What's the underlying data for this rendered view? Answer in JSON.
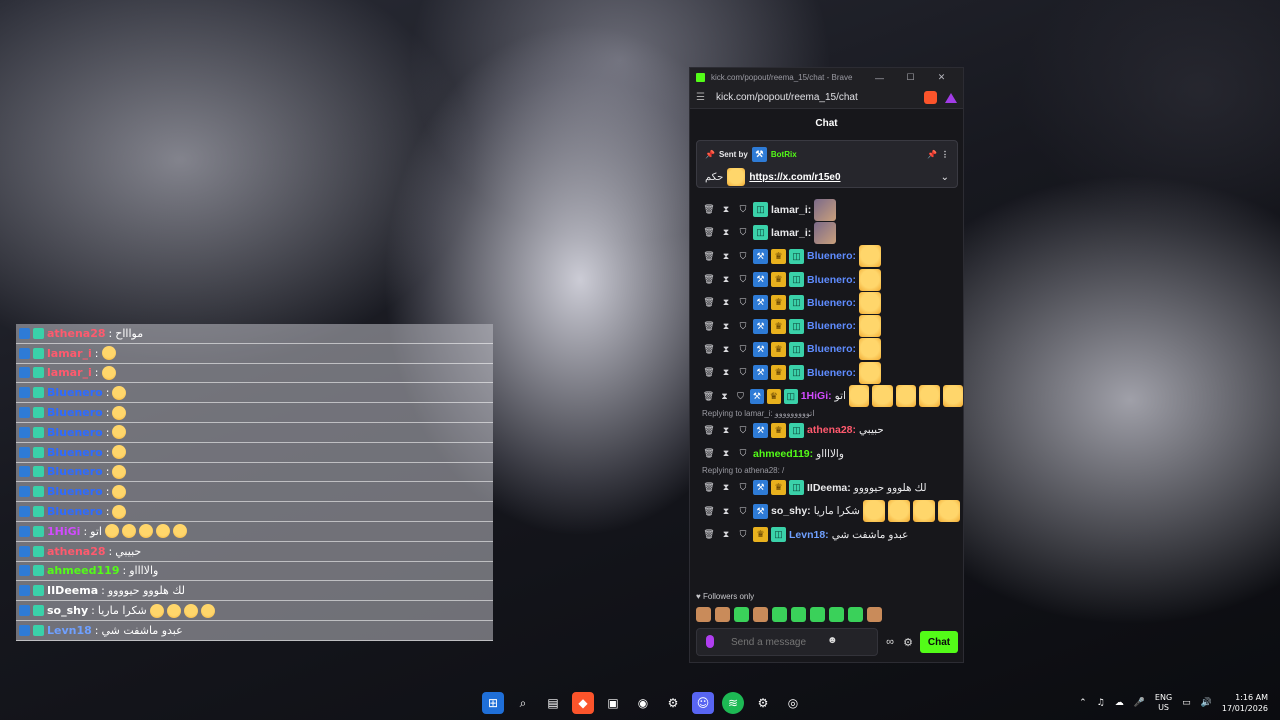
{
  "browser": {
    "title": "kick.com/popout/reema_15/chat - Brave",
    "url": "kick.com/popout/reema_15/chat",
    "window_controls": [
      "—",
      "☐",
      "✕"
    ]
  },
  "chat": {
    "header": "Chat",
    "pinned": {
      "sent_by_label": "Sent by",
      "sender": "BotRix",
      "prefix": "حكم",
      "link": "https://x.com/r15e0"
    },
    "messages": [
      {
        "user": "lamar_i:",
        "color": "#e8e8ea",
        "badges": [
          "sub"
        ],
        "text": "",
        "emotes": [
          "pic"
        ]
      },
      {
        "user": "lamar_i:",
        "color": "#e8e8ea",
        "badges": [
          "sub"
        ],
        "text": "",
        "emotes": [
          "pic"
        ]
      },
      {
        "user": "Bluenero:",
        "color": "#5f8cff",
        "badges": [
          "mod",
          "vip",
          "sub"
        ],
        "text": "",
        "emotes": [
          "duck"
        ]
      },
      {
        "user": "Bluenero:",
        "color": "#5f8cff",
        "badges": [
          "mod",
          "vip",
          "sub"
        ],
        "text": "",
        "emotes": [
          "duck"
        ]
      },
      {
        "user": "Bluenero:",
        "color": "#5f8cff",
        "badges": [
          "mod",
          "vip",
          "sub"
        ],
        "text": "",
        "emotes": [
          "duck"
        ]
      },
      {
        "user": "Bluenero:",
        "color": "#5f8cff",
        "badges": [
          "mod",
          "vip",
          "sub"
        ],
        "text": "",
        "emotes": [
          "duck"
        ]
      },
      {
        "user": "Bluenero:",
        "color": "#5f8cff",
        "badges": [
          "mod",
          "vip",
          "sub"
        ],
        "text": "",
        "emotes": [
          "duck"
        ]
      },
      {
        "user": "Bluenero:",
        "color": "#5f8cff",
        "badges": [
          "mod",
          "vip",
          "sub"
        ],
        "text": "",
        "emotes": [
          "duck"
        ]
      },
      {
        "user": "1HiGi:",
        "color": "#d24bff",
        "badges": [
          "mod",
          "vip",
          "sub"
        ],
        "text": "اتو",
        "emotes": [
          "duck",
          "duck",
          "duck",
          "duck",
          "duck"
        ]
      },
      {
        "reply_to": "Replying to lamar_i: اتووووووووو",
        "user": "athena28:",
        "color": "#ff5a6e",
        "badges": [
          "mod",
          "vip",
          "sub"
        ],
        "text": "حبيبي",
        "emotes": []
      },
      {
        "user": "ahmeed119:",
        "color": "#53fc18",
        "badges": [],
        "text": "والااااو",
        "emotes": []
      },
      {
        "reply_to": "Replying to athena28: /",
        "user": "IIDeema:",
        "color": "#e8e8ea",
        "badges": [
          "mod",
          "vip",
          "sub"
        ],
        "text": "لك هلووو حيوووو",
        "emotes": []
      },
      {
        "user": "so_shy:",
        "color": "#e8e8ea",
        "badges": [
          "mod"
        ],
        "text": "شكرا ماريا",
        "emotes": [
          "duck",
          "duck",
          "duck",
          "duck"
        ]
      },
      {
        "user": "Levn18:",
        "color": "#6fa0ff",
        "badges": [
          "vip",
          "sub"
        ],
        "text": "عبدو ماشفت شي",
        "emotes": []
      }
    ],
    "followers_only": "Followers only",
    "input_placeholder": "Send a message",
    "send_label": "Chat"
  },
  "overlay": {
    "rows": [
      {
        "user": "athena28",
        "color": "#ff5a6e",
        "text": "مواااح",
        "emotes": 0
      },
      {
        "user": "lamar_i",
        "color": "#ff5a6e",
        "text": "",
        "emotes": 1
      },
      {
        "user": "lamar_i",
        "color": "#ff5a6e",
        "text": "",
        "emotes": 1
      },
      {
        "user": "Bluenero",
        "color": "#2e6bff",
        "text": "",
        "emotes": 1
      },
      {
        "user": "Bluenero",
        "color": "#2e6bff",
        "text": "",
        "emotes": 1
      },
      {
        "user": "Bluenero",
        "color": "#2e6bff",
        "text": "",
        "emotes": 1
      },
      {
        "user": "Bluenero",
        "color": "#2e6bff",
        "text": "",
        "emotes": 1
      },
      {
        "user": "Bluenero",
        "color": "#2e6bff",
        "text": "",
        "emotes": 1
      },
      {
        "user": "Bluenero",
        "color": "#2e6bff",
        "text": "",
        "emotes": 1
      },
      {
        "user": "Bluenero",
        "color": "#2e6bff",
        "text": "",
        "emotes": 1
      },
      {
        "user": "1HiGi",
        "color": "#d24bff",
        "text": "اتو",
        "emotes": 5
      },
      {
        "user": "athena28",
        "color": "#ff5a6e",
        "text": "حبيبي",
        "emotes": 0
      },
      {
        "user": "ahmeed119",
        "color": "#53fc18",
        "text": "والااااو",
        "emotes": 0
      },
      {
        "user": "IIDeema",
        "color": "#ffffff",
        "text": "لك هلووو حيوووو",
        "emotes": 0
      },
      {
        "user": "so_shy",
        "color": "#ffffff",
        "text": "شكرا ماريا",
        "emotes": 4
      },
      {
        "user": "Levn18",
        "color": "#6fa0ff",
        "text": "عبدو ماشفت شي",
        "emotes": 0
      }
    ]
  },
  "taskbar": {
    "lang_top": "ENG",
    "lang_bottom": "US",
    "time": "1:16 AM",
    "date": "17/01/2026"
  }
}
